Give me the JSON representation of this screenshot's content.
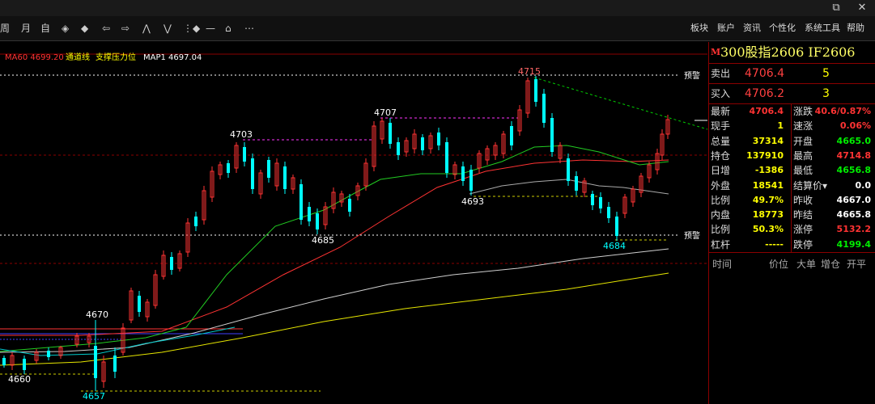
{
  "window": {
    "restore_glyph": "⧉",
    "close_glyph": "✕"
  },
  "toolbar": {
    "period_label": "周",
    "month_label": "月",
    "custom_label": "自",
    "tool_glyphs": [
      "◈",
      "◆",
      "ⵔ",
      "⇦",
      "⇨",
      "⋀",
      "⋁",
      "⋮◆",
      "—",
      "⌂",
      "⋯"
    ],
    "menu": [
      "板块",
      "账户",
      "资讯",
      "个性化",
      "系统工具",
      "帮助"
    ]
  },
  "indicators": [
    {
      "text": "MA60 4699.20",
      "color": "#ff3333"
    },
    {
      "text": "通道线",
      "color": "#ffff00"
    },
    {
      "text": "支撑压力位",
      "color": "#ffff00"
    },
    {
      "text": "MAP1 4697.04",
      "color": "#ffffff"
    }
  ],
  "chart": {
    "price_labels": [
      {
        "text": "4715",
        "color": "#ff6666"
      },
      {
        "text": "4707",
        "color": "#ffffff"
      },
      {
        "text": "4703",
        "color": "#ffffff"
      },
      {
        "text": "4693",
        "color": "#ffffff"
      },
      {
        "text": "4685",
        "color": "#ffffff"
      },
      {
        "text": "4684",
        "color": "#00ffff"
      },
      {
        "text": "4670",
        "color": "#ffffff"
      },
      {
        "text": "4660",
        "color": "#ffffff"
      },
      {
        "text": "4657",
        "color": "#00ffff"
      }
    ],
    "warn_label_top": "预警",
    "warn_label_bottom": "预警"
  },
  "panel": {
    "mark": "M",
    "title": "300股指2606  IF2606",
    "sell": {
      "label": "卖出",
      "price": "4706.4",
      "vol": "5"
    },
    "buy": {
      "label": "买入",
      "price": "4706.2",
      "vol": "3"
    },
    "stats": [
      {
        "l1": "最新",
        "v1": "4706.4",
        "c1": "red",
        "l2": "涨跌",
        "v2": "40.6/0.87%",
        "c2": "red"
      },
      {
        "l1": "现手",
        "v1": "1",
        "c1": "yel",
        "l2": "速涨",
        "v2": "0.06%",
        "c2": "red"
      },
      {
        "l1": "总量",
        "v1": "37314",
        "c1": "yel",
        "l2": "开盘",
        "v2": "4665.0",
        "c2": "grn"
      },
      {
        "l1": "持仓",
        "v1": "137910",
        "c1": "yel",
        "l2": "最高",
        "v2": "4714.8",
        "c2": "red"
      },
      {
        "l1": "日增",
        "v1": "-1386",
        "c1": "yel",
        "l2": "最低",
        "v2": "4656.8",
        "c2": "grn"
      },
      {
        "l1": "外盘",
        "v1": "18541",
        "c1": "yel",
        "l2": "结算价▾",
        "v2": "0.0",
        "c2": "wht"
      },
      {
        "l1": "比例",
        "v1": "49.7%",
        "c1": "yel",
        "l2": "昨收",
        "v2": "4667.0",
        "c2": "wht"
      },
      {
        "l1": "内盘",
        "v1": "18773",
        "c1": "yel",
        "l2": "昨结",
        "v2": "4665.8",
        "c2": "wht"
      },
      {
        "l1": "比例",
        "v1": "50.3%",
        "c1": "yel",
        "l2": "涨停",
        "v2": "5132.2",
        "c2": "red"
      },
      {
        "l1": "杠杆",
        "v1": "-----",
        "c1": "yel",
        "l2": "跌停",
        "v2": "4199.4",
        "c2": "grn"
      }
    ],
    "tick_columns": [
      "时间",
      "价位",
      "大单",
      "增仓",
      "开平"
    ]
  }
}
